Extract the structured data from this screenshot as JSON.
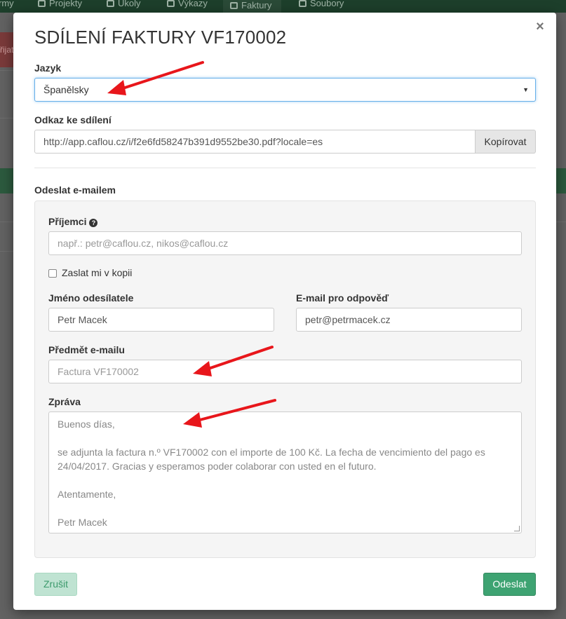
{
  "background_app": {
    "nav": [
      {
        "label": "rmy"
      },
      {
        "label": "Projekty"
      },
      {
        "label": "Úkoly"
      },
      {
        "label": "Výkazy"
      },
      {
        "label": "Faktury"
      },
      {
        "label": "Soubory"
      }
    ],
    "side_button_label": "řijat"
  },
  "modal": {
    "title": "SDÍLENÍ FAKTURY VF170002",
    "close_label": "×",
    "language": {
      "label": "Jazyk",
      "selected": "Španělsky",
      "caret": "▼"
    },
    "share_link": {
      "label": "Odkaz ke sdílení",
      "value": "http://app.caflou.cz/i/f2e6fd58247b391d9552be30.pdf?locale=es",
      "copy_button": "Kopírovat"
    },
    "email_section": {
      "heading": "Odeslat e-mailem",
      "recipients_label": "Příjemci",
      "recipients_help_icon": "question-circle-icon",
      "recipients_help_glyph": "?",
      "recipients_placeholder": "např.: petr@caflou.cz, nikos@caflou.cz",
      "send_copy_label": "Zaslat mi v kopii",
      "sender_name_label": "Jméno odesílatele",
      "sender_name_value": "Petr Macek",
      "reply_email_label": "E-mail pro odpověď",
      "reply_email_value": "petr@petrmacek.cz",
      "subject_label": "Předmět e-mailu",
      "subject_placeholder": "Factura VF170002",
      "message_label": "Zpráva",
      "message_lines": [
        "Buenos días,",
        "",
        "se adjunta la factura n.º VF170002 con el importe de 100 Kč. La fecha de vencimiento del pago es 24/04/2017. Gracias y esperamos poder colaborar con usted en el futuro.",
        "",
        "Atentamente,",
        "",
        "Petr Macek"
      ]
    },
    "cancel_button": "Zrušit",
    "send_button": "Odeslat"
  },
  "colors": {
    "accent_green": "#3ea372",
    "arrow_red": "#e8161b",
    "focus_blue": "#66afe9"
  }
}
